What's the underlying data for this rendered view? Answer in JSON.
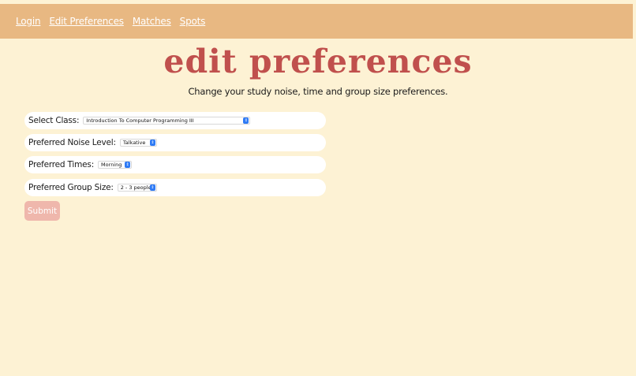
{
  "nav": {
    "items": [
      "Login",
      "Edit Preferences",
      "Matches",
      "Spots"
    ]
  },
  "page": {
    "title": "edit preferences",
    "subtitle": "Change your study noise, time and group size preferences."
  },
  "form": {
    "class_label": "Select Class:",
    "class_value": "Introduction To Computer Programming III",
    "noise_label": "Preferred Noise Level:",
    "noise_value": "Talkative",
    "times_label": "Preferred Times:",
    "times_value": "Morning",
    "group_label": "Preferred Group Size:",
    "group_value": "2 - 3 people",
    "submit_label": "Submit"
  },
  "colors": {
    "background": "#fdf2d4",
    "nav_background": "#e8b882",
    "title": "#c0504d",
    "submit_background": "#efb7ac",
    "select_arrow": "#2f7bf5"
  },
  "icons": {
    "select_arrow": "chevron-up-down-icon"
  }
}
